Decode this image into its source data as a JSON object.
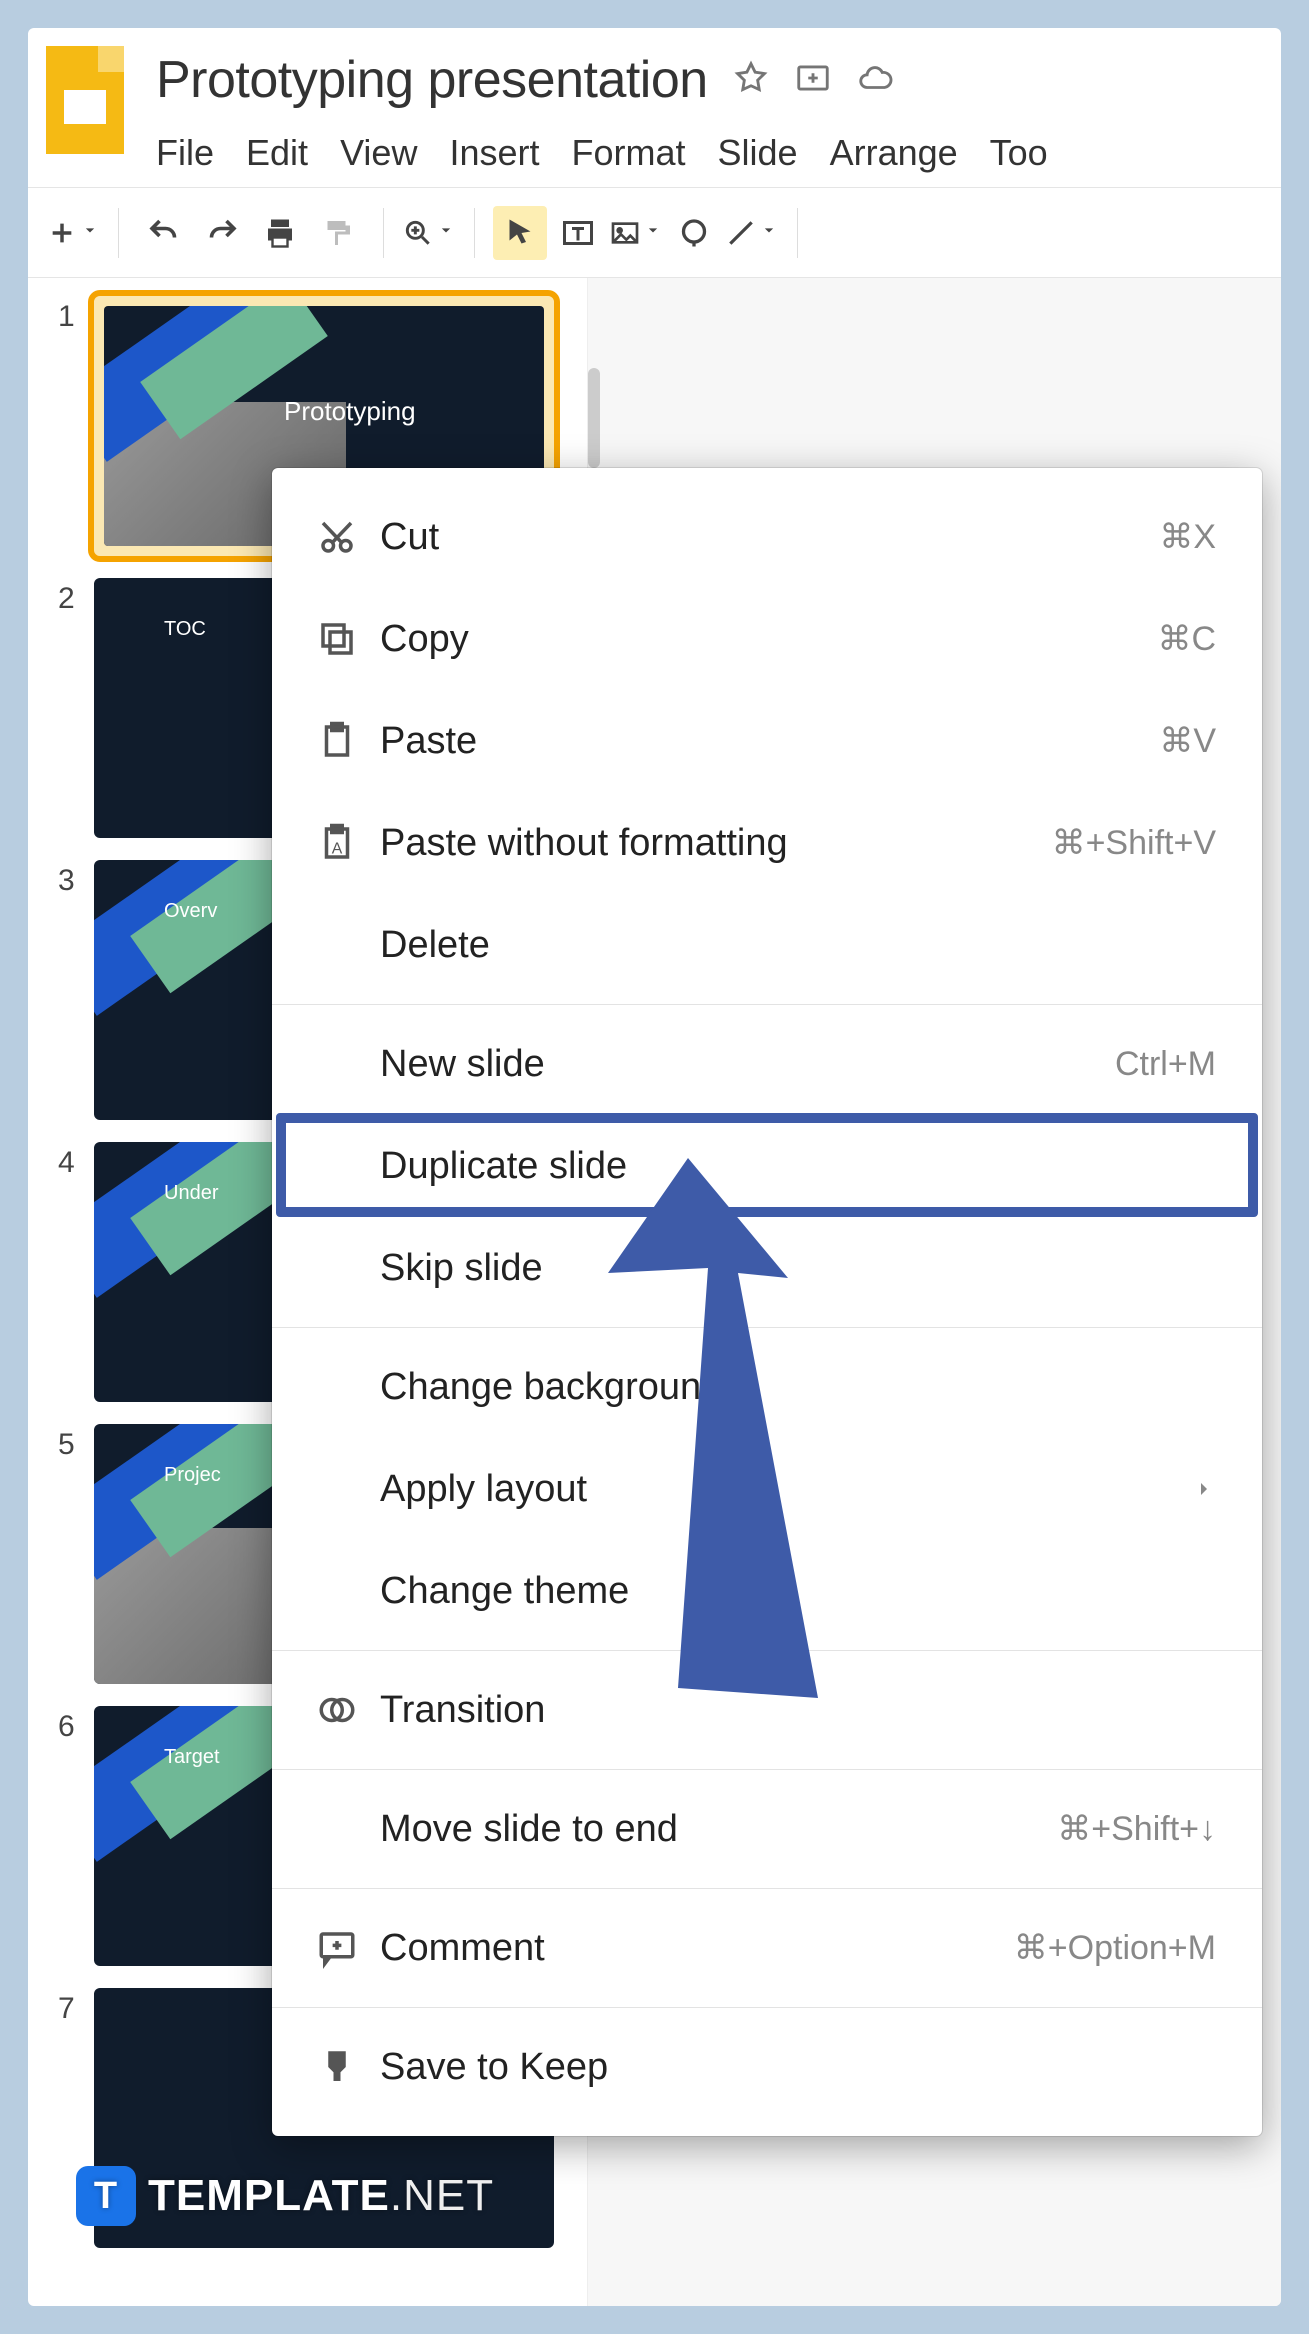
{
  "doc_title": "Prototyping presentation",
  "menus": [
    "File",
    "Edit",
    "View",
    "Insert",
    "Format",
    "Slide",
    "Arrange",
    "Too"
  ],
  "slides": [
    {
      "num": "1",
      "label": "Prototyping",
      "selected": true,
      "ribbon": true,
      "img": true
    },
    {
      "num": "2",
      "label": "TOC",
      "selected": false,
      "ribbon": false
    },
    {
      "num": "3",
      "label": "Overv",
      "selected": false,
      "ribbon": true
    },
    {
      "num": "4",
      "label": "Under",
      "selected": false,
      "ribbon": true
    },
    {
      "num": "5",
      "label": "Projec",
      "selected": false,
      "ribbon": true,
      "img": true
    },
    {
      "num": "6",
      "label": "Target",
      "selected": false,
      "ribbon": true
    },
    {
      "num": "7",
      "label": "",
      "selected": false,
      "ribbon": false
    }
  ],
  "context_menu": {
    "groups": [
      [
        {
          "icon": "cut",
          "label": "Cut",
          "shortcut": "⌘X"
        },
        {
          "icon": "copy",
          "label": "Copy",
          "shortcut": "⌘C"
        },
        {
          "icon": "paste",
          "label": "Paste",
          "shortcut": "⌘V"
        },
        {
          "icon": "paste-plain",
          "label": "Paste without formatting",
          "shortcut": "⌘+Shift+V"
        },
        {
          "icon": "",
          "label": "Delete",
          "shortcut": ""
        }
      ],
      [
        {
          "icon": "",
          "label": "New slide",
          "shortcut": "Ctrl+M"
        },
        {
          "icon": "",
          "label": "Duplicate slide",
          "shortcut": "",
          "highlight": true
        },
        {
          "icon": "",
          "label": "Skip slide",
          "shortcut": ""
        }
      ],
      [
        {
          "icon": "",
          "label": "Change background",
          "shortcut": ""
        },
        {
          "icon": "",
          "label": "Apply layout",
          "shortcut": "",
          "submenu": true
        },
        {
          "icon": "",
          "label": "Change theme",
          "shortcut": ""
        }
      ],
      [
        {
          "icon": "transition",
          "label": "Transition",
          "shortcut": ""
        }
      ],
      [
        {
          "icon": "",
          "label": "Move slide to end",
          "shortcut": "⌘+Shift+↓"
        }
      ],
      [
        {
          "icon": "comment",
          "label": "Comment",
          "shortcut": "⌘+Option+M"
        }
      ],
      [
        {
          "icon": "keep",
          "label": "Save to Keep",
          "shortcut": ""
        }
      ]
    ]
  },
  "watermark": {
    "badge": "T",
    "text": "TEMPLATE",
    "suffix": ".NET"
  }
}
